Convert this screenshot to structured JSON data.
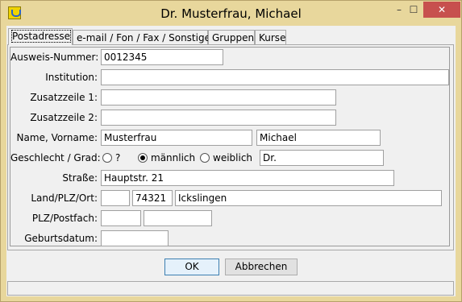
{
  "window": {
    "title": "Dr. Musterfrau, Michael",
    "minimize": "–",
    "maximize": "☐",
    "close": "✕"
  },
  "tabs": [
    "Postadresse",
    "e-mail / Fon / Fax / Sonstiges",
    "Gruppen",
    "Kurse"
  ],
  "form": {
    "ausweis_label": "Ausweis-Nummer:",
    "ausweis_value": "0012345",
    "institution_label": "Institution:",
    "institution_value": "",
    "zusatz1_label": "Zusatzzeile 1:",
    "zusatz1_value": "",
    "zusatz2_label": "Zusatzzeile 2:",
    "zusatz2_value": "",
    "name_label": "Name, Vorname:",
    "nachname_value": "Musterfrau",
    "vorname_value": "Michael",
    "geschlecht_label": "Geschlecht / Grad:",
    "geschlecht_options": [
      "?",
      "männlich",
      "weiblich"
    ],
    "geschlecht_selected": "männlich",
    "grad_value": "Dr.",
    "strasse_label": "Straße:",
    "strasse_value": "Hauptstr. 21",
    "ort_label": "Land/PLZ/Ort:",
    "land_value": "",
    "plz_value": "74321",
    "ort_value": "Ickslingen",
    "postfach_label": "PLZ/Postfach:",
    "postfach_plz_value": "",
    "postfach_value": "",
    "geburtsdatum_label": "Geburtsdatum:",
    "geburtsdatum_value": ""
  },
  "buttons": {
    "ok": "OK",
    "cancel": "Abbrechen"
  }
}
